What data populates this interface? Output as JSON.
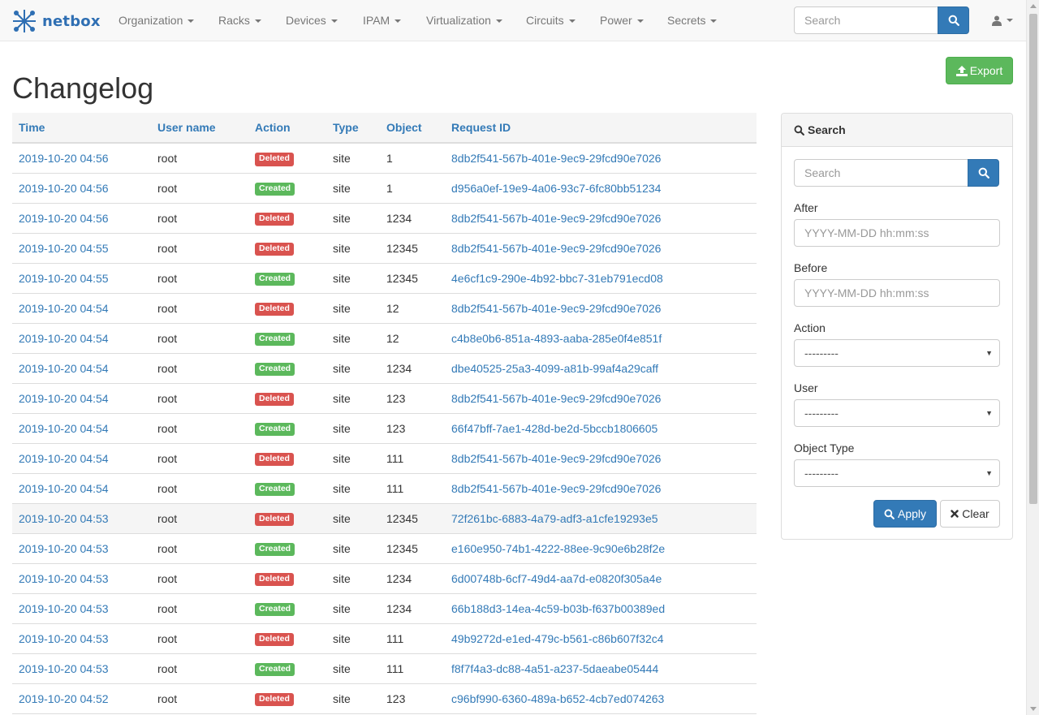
{
  "nav": {
    "brand": "netbox",
    "items": [
      {
        "label": "Organization"
      },
      {
        "label": "Racks"
      },
      {
        "label": "Devices"
      },
      {
        "label": "IPAM"
      },
      {
        "label": "Virtualization"
      },
      {
        "label": "Circuits"
      },
      {
        "label": "Power"
      },
      {
        "label": "Secrets"
      }
    ],
    "search_placeholder": "Search"
  },
  "page": {
    "title": "Changelog",
    "export_label": "Export"
  },
  "table": {
    "columns": [
      "Time",
      "User name",
      "Action",
      "Type",
      "Object",
      "Request ID"
    ],
    "rows": [
      {
        "time": "2019-10-20 04:56",
        "user": "root",
        "action": "Deleted",
        "type": "site",
        "object": "1",
        "request_id": "8db2f541-567b-401e-9ec9-29fcd90e7026"
      },
      {
        "time": "2019-10-20 04:56",
        "user": "root",
        "action": "Created",
        "type": "site",
        "object": "1",
        "request_id": "d956a0ef-19e9-4a06-93c7-6fc80bb51234"
      },
      {
        "time": "2019-10-20 04:56",
        "user": "root",
        "action": "Deleted",
        "type": "site",
        "object": "1234",
        "request_id": "8db2f541-567b-401e-9ec9-29fcd90e7026"
      },
      {
        "time": "2019-10-20 04:55",
        "user": "root",
        "action": "Deleted",
        "type": "site",
        "object": "12345",
        "request_id": "8db2f541-567b-401e-9ec9-29fcd90e7026"
      },
      {
        "time": "2019-10-20 04:55",
        "user": "root",
        "action": "Created",
        "type": "site",
        "object": "12345",
        "request_id": "4e6cf1c9-290e-4b92-bbc7-31eb791ecd08"
      },
      {
        "time": "2019-10-20 04:54",
        "user": "root",
        "action": "Deleted",
        "type": "site",
        "object": "12",
        "request_id": "8db2f541-567b-401e-9ec9-29fcd90e7026"
      },
      {
        "time": "2019-10-20 04:54",
        "user": "root",
        "action": "Created",
        "type": "site",
        "object": "12",
        "request_id": "c4b8e0b6-851a-4893-aaba-285e0f4e851f"
      },
      {
        "time": "2019-10-20 04:54",
        "user": "root",
        "action": "Created",
        "type": "site",
        "object": "1234",
        "request_id": "dbe40525-25a3-4099-a81b-99af4a29caff"
      },
      {
        "time": "2019-10-20 04:54",
        "user": "root",
        "action": "Deleted",
        "type": "site",
        "object": "123",
        "request_id": "8db2f541-567b-401e-9ec9-29fcd90e7026"
      },
      {
        "time": "2019-10-20 04:54",
        "user": "root",
        "action": "Created",
        "type": "site",
        "object": "123",
        "request_id": "66f47bff-7ae1-428d-be2d-5bccb1806605"
      },
      {
        "time": "2019-10-20 04:54",
        "user": "root",
        "action": "Deleted",
        "type": "site",
        "object": "111",
        "request_id": "8db2f541-567b-401e-9ec9-29fcd90e7026"
      },
      {
        "time": "2019-10-20 04:54",
        "user": "root",
        "action": "Created",
        "type": "site",
        "object": "111",
        "request_id": "8db2f541-567b-401e-9ec9-29fcd90e7026"
      },
      {
        "time": "2019-10-20 04:53",
        "user": "root",
        "action": "Deleted",
        "type": "site",
        "object": "12345",
        "request_id": "72f261bc-6883-4a79-adf3-a1cfe19293e5"
      },
      {
        "time": "2019-10-20 04:53",
        "user": "root",
        "action": "Created",
        "type": "site",
        "object": "12345",
        "request_id": "e160e950-74b1-4222-88ee-9c90e6b28f2e"
      },
      {
        "time": "2019-10-20 04:53",
        "user": "root",
        "action": "Deleted",
        "type": "site",
        "object": "1234",
        "request_id": "6d00748b-6cf7-49d4-aa7d-e0820f305a4e"
      },
      {
        "time": "2019-10-20 04:53",
        "user": "root",
        "action": "Created",
        "type": "site",
        "object": "1234",
        "request_id": "66b188d3-14ea-4c59-b03b-f637b00389ed"
      },
      {
        "time": "2019-10-20 04:53",
        "user": "root",
        "action": "Deleted",
        "type": "site",
        "object": "111",
        "request_id": "49b9272d-e1ed-479c-b561-c86b607f32c4"
      },
      {
        "time": "2019-10-20 04:53",
        "user": "root",
        "action": "Created",
        "type": "site",
        "object": "111",
        "request_id": "f8f7f4a3-dc88-4a51-a237-5daeabe05444"
      },
      {
        "time": "2019-10-20 04:52",
        "user": "root",
        "action": "Deleted",
        "type": "site",
        "object": "123",
        "request_id": "c96bf990-6360-489a-b652-4cb7ed074263"
      }
    ]
  },
  "filter": {
    "heading": "Search",
    "search_placeholder": "Search",
    "after_label": "After",
    "after_placeholder": "YYYY-MM-DD hh:mm:ss",
    "before_label": "Before",
    "before_placeholder": "YYYY-MM-DD hh:mm:ss",
    "action_label": "Action",
    "action_value": "---------",
    "user_label": "User",
    "user_value": "---------",
    "object_type_label": "Object Type",
    "object_type_value": "---------",
    "apply_label": "Apply",
    "clear_label": "Clear"
  },
  "colors": {
    "primary": "#337ab7",
    "success": "#5cb85c",
    "danger": "#d9534f"
  }
}
